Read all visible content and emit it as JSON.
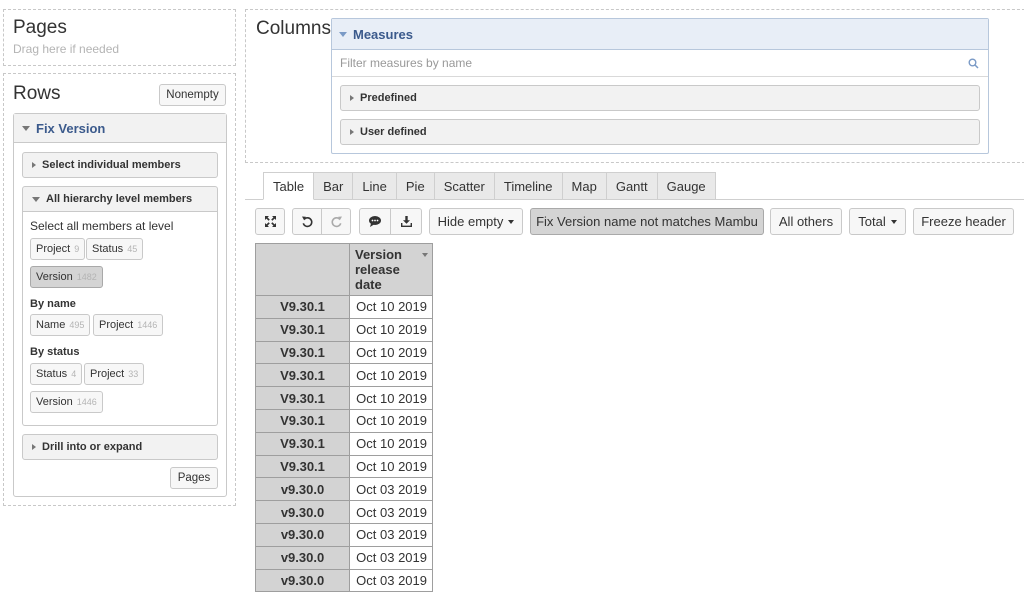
{
  "pages": {
    "title": "Pages",
    "hint": "Drag here if needed"
  },
  "rows": {
    "title": "Rows",
    "nonempty_label": "Nonempty",
    "dimension": {
      "title": "Fix Version",
      "select_individual": "Select individual members",
      "all_hierarchy": "All hierarchy level members",
      "select_all_label": "Select all members at level",
      "levels": [
        {
          "name": "Project",
          "count": "9"
        },
        {
          "name": "Status",
          "count": "45"
        },
        {
          "name": "Version",
          "count": "1482",
          "selected": true
        }
      ],
      "by_name_label": "By name",
      "by_name": [
        {
          "name": "Name",
          "count": "495"
        },
        {
          "name": "Project",
          "count": "1446"
        }
      ],
      "by_status_label": "By status",
      "by_status": [
        {
          "name": "Status",
          "count": "4"
        },
        {
          "name": "Project",
          "count": "33"
        },
        {
          "name": "Version",
          "count": "1446"
        }
      ],
      "drill_label": "Drill into or expand",
      "pages_button": "Pages"
    }
  },
  "columns": {
    "title": "Columns",
    "measures": {
      "title": "Measures",
      "filter_placeholder": "Filter measures by name",
      "groups": [
        "Predefined",
        "User defined"
      ]
    }
  },
  "tabs": [
    {
      "label": "Table",
      "active": true
    },
    {
      "label": "Bar"
    },
    {
      "label": "Line"
    },
    {
      "label": "Pie"
    },
    {
      "label": "Scatter"
    },
    {
      "label": "Timeline"
    },
    {
      "label": "Map"
    },
    {
      "label": "Gantt"
    },
    {
      "label": "Gauge"
    }
  ],
  "toolbar": {
    "icons": [
      "fullscreen-icon",
      "undo-icon",
      "redo-icon",
      "comment-icon",
      "download-icon"
    ],
    "hide_empty": "Hide empty",
    "filter_label": "Fix Version name not matches Mambu",
    "all_others": "All others",
    "total": "Total",
    "freeze_header": "Freeze header"
  },
  "table": {
    "column_header": "Version release date",
    "rows": [
      {
        "member": "V9.30.1",
        "value": "Oct 10 2019"
      },
      {
        "member": "V9.30.1",
        "value": "Oct 10 2019"
      },
      {
        "member": "V9.30.1",
        "value": "Oct 10 2019"
      },
      {
        "member": "V9.30.1",
        "value": "Oct 10 2019"
      },
      {
        "member": "V9.30.1",
        "value": "Oct 10 2019"
      },
      {
        "member": "V9.30.1",
        "value": "Oct 10 2019"
      },
      {
        "member": "V9.30.1",
        "value": "Oct 10 2019"
      },
      {
        "member": "V9.30.1",
        "value": "Oct 10 2019"
      },
      {
        "member": "v9.30.0",
        "value": "Oct 03 2019"
      },
      {
        "member": "v9.30.0",
        "value": "Oct 03 2019"
      },
      {
        "member": "v9.30.0",
        "value": "Oct 03 2019"
      },
      {
        "member": "v9.30.0",
        "value": "Oct 03 2019"
      },
      {
        "member": "v9.30.0",
        "value": "Oct 03 2019"
      }
    ]
  },
  "colors": {
    "accent": "#3b5a8c",
    "header_bg": "#d3d3d3",
    "active_bg": "#d4d4d4"
  }
}
